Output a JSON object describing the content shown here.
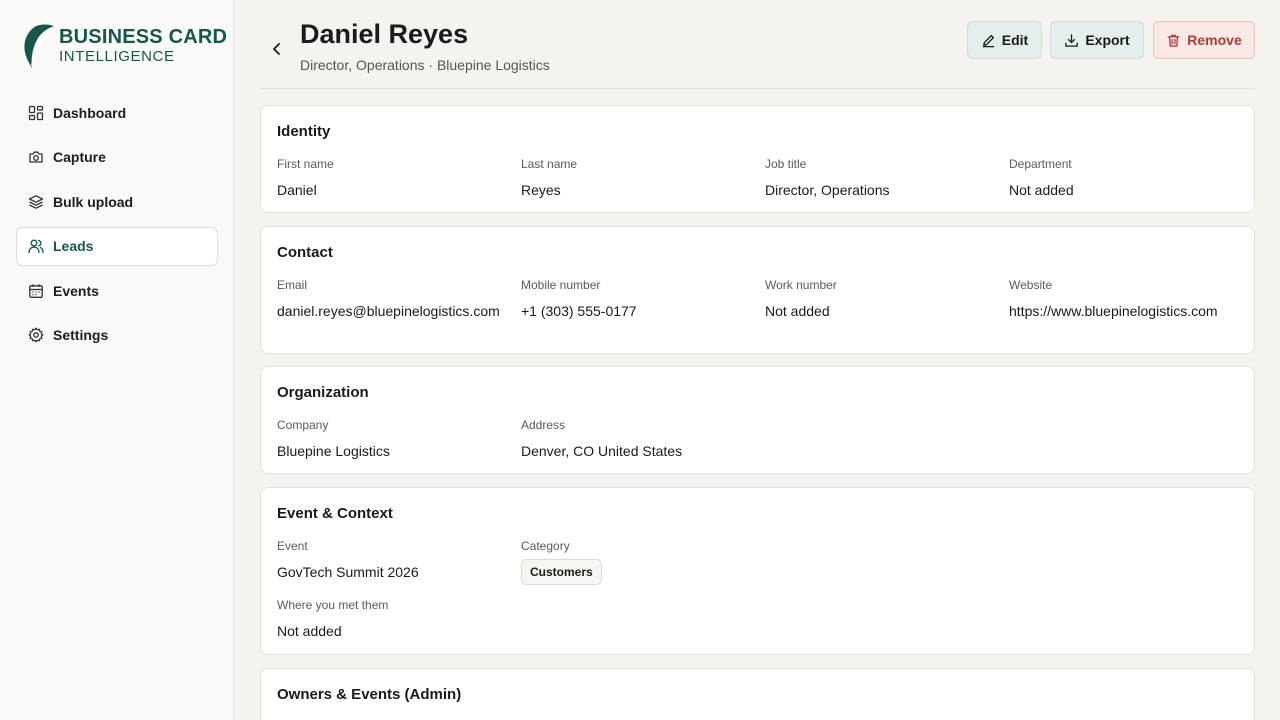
{
  "brand": {
    "line1": "BUSINESS CARD",
    "line2": "INTELLIGENCE",
    "color": "#17574a"
  },
  "nav": [
    {
      "label": "Dashboard",
      "icon": "dashboard-icon"
    },
    {
      "label": "Capture",
      "icon": "camera-icon"
    },
    {
      "label": "Bulk upload",
      "icon": "layers-icon"
    },
    {
      "label": "Leads",
      "icon": "users-icon",
      "active": true
    },
    {
      "label": "Events",
      "icon": "calendar-icon"
    },
    {
      "label": "Settings",
      "icon": "gear-icon"
    }
  ],
  "header": {
    "title": "Daniel Reyes",
    "subtitle": "Director, Operations · Bluepine Logistics",
    "edit_label": "Edit",
    "export_label": "Export",
    "remove_label": "Remove"
  },
  "identity": {
    "title": "Identity",
    "fields": [
      {
        "label": "First name",
        "value": "Daniel"
      },
      {
        "label": "Last name",
        "value": "Reyes"
      },
      {
        "label": "Job title",
        "value": "Director, Operations"
      },
      {
        "label": "Department",
        "value": "Not added"
      }
    ]
  },
  "contact": {
    "title": "Contact",
    "fields": [
      {
        "label": "Email",
        "value": "daniel.reyes@bluepinelogistics.com"
      },
      {
        "label": "Mobile number",
        "value": "+1 (303) 555-0177"
      },
      {
        "label": "Work number",
        "value": "Not added"
      },
      {
        "label": "Website",
        "value": "https://www.bluepinelogistics.com"
      }
    ]
  },
  "organization": {
    "title": "Organization",
    "fields": [
      {
        "label": "Company",
        "value": "Bluepine Logistics"
      },
      {
        "label": "Address",
        "value": "Denver, CO United States"
      }
    ]
  },
  "event_context": {
    "title": "Event & Context",
    "event_label": "Event",
    "event_value": "GovTech Summit 2026",
    "category_label": "Category",
    "category_value": "Customers",
    "met_label": "Where you met them",
    "met_value": "Not added"
  },
  "owners": {
    "title": "Owners & Events (Admin)"
  }
}
